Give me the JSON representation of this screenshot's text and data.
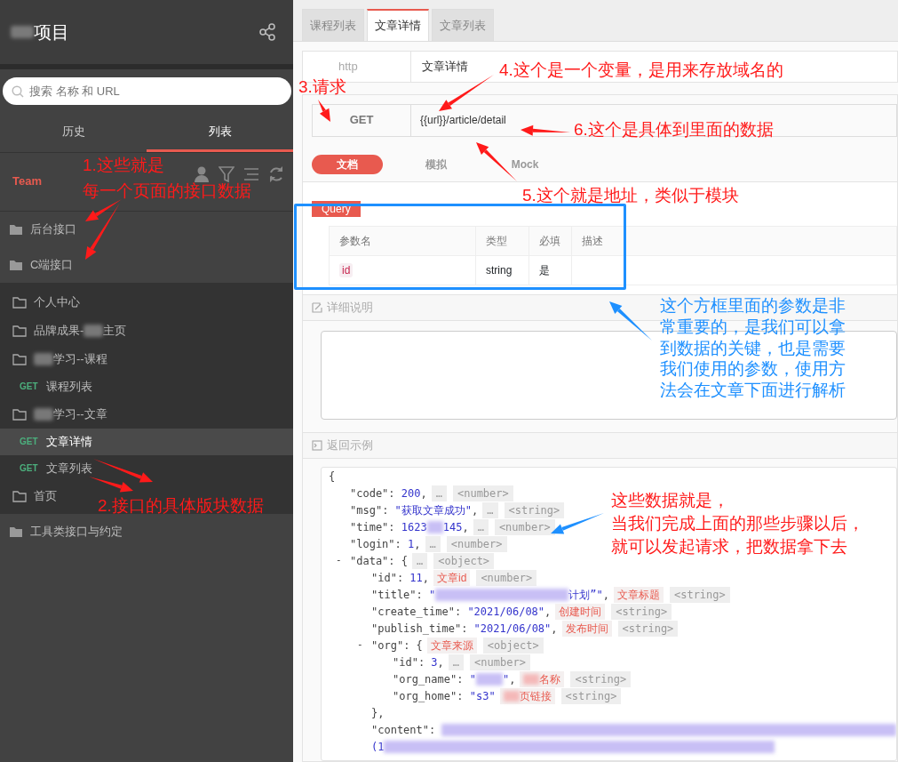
{
  "sidebar": {
    "project_title": "项目",
    "search": {
      "placeholder": "搜索 名称 和 URL"
    },
    "tabs": [
      {
        "label": "历史",
        "selected": false
      },
      {
        "label": "列表",
        "selected": true
      }
    ],
    "team_label": "Team",
    "tree": [
      {
        "kind": "folder",
        "segments": [
          {
            "kind": "text",
            "text": "后台接口"
          }
        ],
        "selected": false
      },
      {
        "kind": "folder",
        "segments": [
          {
            "kind": "text",
            "text": "C端接口"
          }
        ],
        "selected": false,
        "children": [
          {
            "kind": "folder",
            "segments": [
              {
                "kind": "text",
                "text": "个人中心"
              }
            ],
            "selected": false
          },
          {
            "kind": "folder",
            "segments": [
              {
                "kind": "text",
                "text": "品牌成果-"
              },
              {
                "kind": "blur"
              },
              {
                "kind": "text",
                "text": "主页"
              }
            ],
            "selected": false
          },
          {
            "kind": "folder",
            "segments": [
              {
                "kind": "blur"
              },
              {
                "kind": "text",
                "text": "学习--课程"
              }
            ],
            "selected": false,
            "children": [
              {
                "kind": "api",
                "method": "GET",
                "segments": [
                  {
                    "kind": "text",
                    "text": "课程列表"
                  }
                ],
                "selected": false
              }
            ]
          },
          {
            "kind": "folder",
            "segments": [
              {
                "kind": "blur"
              },
              {
                "kind": "text",
                "text": "学习--文章"
              }
            ],
            "selected": false,
            "children": [
              {
                "kind": "api",
                "method": "GET",
                "segments": [
                  {
                    "kind": "text",
                    "text": "文章详情"
                  }
                ],
                "selected": true
              },
              {
                "kind": "api",
                "method": "GET",
                "segments": [
                  {
                    "kind": "text",
                    "text": "文章列表"
                  }
                ],
                "selected": false
              }
            ]
          },
          {
            "kind": "folder",
            "segments": [
              {
                "kind": "text",
                "text": "首页"
              }
            ],
            "selected": false
          }
        ]
      },
      {
        "kind": "folder",
        "segments": [
          {
            "kind": "text",
            "text": "工具类接口与约定"
          }
        ],
        "selected": false
      }
    ]
  },
  "main": {
    "tabs": [
      {
        "label": "课程列表",
        "selected": false
      },
      {
        "label": "文章详情",
        "selected": true
      },
      {
        "label": "文章列表",
        "selected": false
      }
    ],
    "protocol": "http",
    "api_name": "文章详情",
    "method": "GET",
    "url": "{{url}}/article/detail",
    "mode_tabs": [
      {
        "label": "文档",
        "selected": true
      },
      {
        "label": "模拟",
        "selected": false
      },
      {
        "label": "Mock",
        "selected": false
      }
    ],
    "query_badge": "Query",
    "params": {
      "columns": [
        "参数名",
        "类型",
        "必填",
        "描述"
      ],
      "rows": [
        [
          "id",
          "string",
          "是",
          ""
        ]
      ]
    },
    "detail_heading": "详细说明",
    "example_heading": "返回示例",
    "code_lines": [
      {
        "segments": [
          {
            "kind": "plain",
            "text": "{"
          }
        ],
        "children": [
          {
            "segments": [
              {
                "kind": "key",
                "text": "\"code\""
              },
              {
                "kind": "plain",
                "text": ": "
              },
              {
                "kind": "value",
                "text": "200"
              },
              {
                "kind": "plain",
                "text": ","
              }
            ],
            "note": {
              "kind": "dots",
              "text": "…"
            },
            "type": "<number>"
          },
          {
            "segments": [
              {
                "kind": "key",
                "text": "\"msg\""
              },
              {
                "kind": "plain",
                "text": ": "
              },
              {
                "kind": "value",
                "text": "\"获取文章成功\""
              },
              {
                "kind": "plain",
                "text": ","
              }
            ],
            "note": {
              "kind": "dots",
              "text": "…"
            },
            "type": "<string>"
          },
          {
            "segments": [
              {
                "kind": "key",
                "text": "\"time\""
              },
              {
                "kind": "plain",
                "text": ": "
              },
              {
                "kind": "value",
                "text": "1623"
              },
              {
                "kind": "blur"
              },
              {
                "kind": "value",
                "text": "145"
              },
              {
                "kind": "plain",
                "text": ","
              }
            ],
            "note": {
              "kind": "dots",
              "text": "…"
            },
            "type": "<number>"
          },
          {
            "segments": [
              {
                "kind": "key",
                "text": "\"login\""
              },
              {
                "kind": "plain",
                "text": ": "
              },
              {
                "kind": "value",
                "text": "1"
              },
              {
                "kind": "plain",
                "text": ","
              }
            ],
            "note": {
              "kind": "dots",
              "text": "…"
            },
            "type": "<number>"
          },
          {
            "toggle": "-",
            "segments": [
              {
                "kind": "key",
                "text": "\"data\""
              },
              {
                "kind": "plain",
                "text": ": {"
              }
            ],
            "note": {
              "kind": "dots",
              "text": "…"
            },
            "type": "<object>",
            "children": [
              {
                "segments": [
                  {
                    "kind": "key",
                    "text": "\"id\""
                  },
                  {
                    "kind": "plain",
                    "text": ": "
                  },
                  {
                    "kind": "value",
                    "text": "11"
                  },
                  {
                    "kind": "plain",
                    "text": ","
                  }
                ],
                "note": {
                  "kind": "label",
                  "text": "文章id"
                },
                "type": "<number>"
              },
              {
                "segments": [
                  {
                    "kind": "key",
                    "text": "\"title\""
                  },
                  {
                    "kind": "plain",
                    "text": ": "
                  },
                  {
                    "kind": "value",
                    "text": "\""
                  },
                  {
                    "kind": "blur"
                  },
                  {
                    "kind": "value",
                    "text": "计划”\""
                  },
                  {
                    "kind": "plain",
                    "text": ","
                  }
                ],
                "note": {
                  "kind": "label",
                  "text": "文章标题"
                },
                "type": "<string>"
              },
              {
                "segments": [
                  {
                    "kind": "key",
                    "text": "\"create_time\""
                  },
                  {
                    "kind": "plain",
                    "text": ": "
                  },
                  {
                    "kind": "value",
                    "text": "\"2021/06/08\""
                  },
                  {
                    "kind": "plain",
                    "text": ","
                  }
                ],
                "note": {
                  "kind": "label",
                  "text": "创建时间"
                },
                "type": "<string>"
              },
              {
                "segments": [
                  {
                    "kind": "key",
                    "text": "\"publish_time\""
                  },
                  {
                    "kind": "plain",
                    "text": ": "
                  },
                  {
                    "kind": "value",
                    "text": "\"2021/06/08\""
                  },
                  {
                    "kind": "plain",
                    "text": ","
                  }
                ],
                "note": {
                  "kind": "label",
                  "text": "发布时间"
                },
                "type": "<string>"
              },
              {
                "toggle": "-",
                "segments": [
                  {
                    "kind": "key",
                    "text": "\"org\""
                  },
                  {
                    "kind": "plain",
                    "text": ": {"
                  }
                ],
                "note": {
                  "kind": "label",
                  "text": "文章来源"
                },
                "type": "<object>",
                "children": [
                  {
                    "segments": [
                      {
                        "kind": "key",
                        "text": "\"id\""
                      },
                      {
                        "kind": "plain",
                        "text": ": "
                      },
                      {
                        "kind": "value",
                        "text": "3"
                      },
                      {
                        "kind": "plain",
                        "text": ","
                      }
                    ],
                    "note": {
                      "kind": "dots",
                      "text": "…"
                    },
                    "type": "<number>"
                  },
                  {
                    "segments": [
                      {
                        "kind": "key",
                        "text": "\"org_name\""
                      },
                      {
                        "kind": "plain",
                        "text": ": "
                      },
                      {
                        "kind": "value",
                        "text": "\""
                      },
                      {
                        "kind": "blur"
                      },
                      {
                        "kind": "value",
                        "text": "\""
                      },
                      {
                        "kind": "plain",
                        "text": ","
                      }
                    ],
                    "note": {
                      "kind": "label_blurred",
                      "text": "名称"
                    },
                    "type": "<string>"
                  },
                  {
                    "segments": [
                      {
                        "kind": "key",
                        "text": "\"org_home\""
                      },
                      {
                        "kind": "plain",
                        "text": ": "
                      },
                      {
                        "kind": "value",
                        "text": "\"s3\""
                      }
                    ],
                    "note": {
                      "kind": "label_blurred",
                      "text": "页链接"
                    },
                    "type": "<string>"
                  }
                ]
              },
              {
                "segments": [
                  {
                    "kind": "plain",
                    "text": "},"
                  }
                ]
              },
              {
                "segments": [
                  {
                    "kind": "key",
                    "text": "\"content\""
                  },
                  {
                    "kind": "plain",
                    "text": ": "
                  },
                  {
                    "kind": "blur"
                  }
                ]
              },
              {
                "segments": [
                  {
                    "kind": "value",
                    "text": "(1"
                  },
                  {
                    "kind": "blur"
                  }
                ]
              }
            ]
          }
        ]
      }
    ]
  },
  "annotations": [
    {
      "kind": "red",
      "lines": [
        "1.这些就是",
        "每一个页面的接口数据"
      ]
    },
    {
      "kind": "red",
      "lines": [
        "2.接口的具体版块数据"
      ]
    },
    {
      "kind": "red",
      "lines": [
        "3.请求"
      ]
    },
    {
      "kind": "red",
      "lines": [
        "4.这个是一个变量，是用来存放域名的"
      ]
    },
    {
      "kind": "red",
      "lines": [
        "6.这个是具体到里面的数据"
      ]
    },
    {
      "kind": "red",
      "lines": [
        "5.这个就是地址，类似于模块"
      ]
    },
    {
      "kind": "blue",
      "lines": [
        "这个方框里面的参数是非",
        "常重要的，是我们可以拿",
        "到数据的关键，也是需要",
        "我们使用的参数，使用方",
        "法会在文章下面进行解析"
      ]
    },
    {
      "kind": "red",
      "lines": [
        "这些数据就是，",
        "当我们完成上面的那些步骤以后，",
        "就可以发起请求，把数据拿下去"
      ]
    }
  ]
}
